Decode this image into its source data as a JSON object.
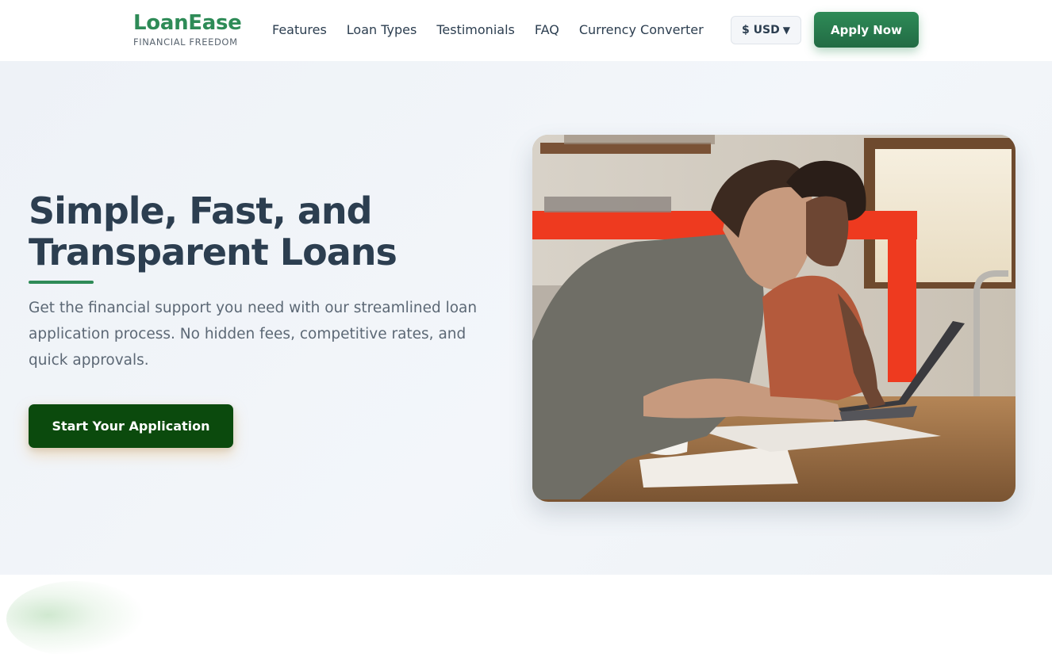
{
  "brand": {
    "name": "LoanEase",
    "tagline": "FINANCIAL FREEDOM"
  },
  "nav": {
    "links": [
      "Features",
      "Loan Types",
      "Testimonials",
      "FAQ",
      "Currency Converter"
    ]
  },
  "currency": {
    "selected": "$ USD",
    "caret": "▼"
  },
  "header": {
    "apply_label": "Apply Now"
  },
  "hero": {
    "title_line1": "Simple, Fast, and",
    "title_line2": "Transparent Loans",
    "description": "Get the financial support you need with our streamlined loan application process. No hidden fees, competitive rates, and quick approvals.",
    "cta_label": "Start Your Application"
  },
  "colors": {
    "brand_green": "#2e8b57",
    "cta_dark_green": "#0b4a0d",
    "heading": "#2c3e50",
    "body_text": "#5c6875"
  }
}
